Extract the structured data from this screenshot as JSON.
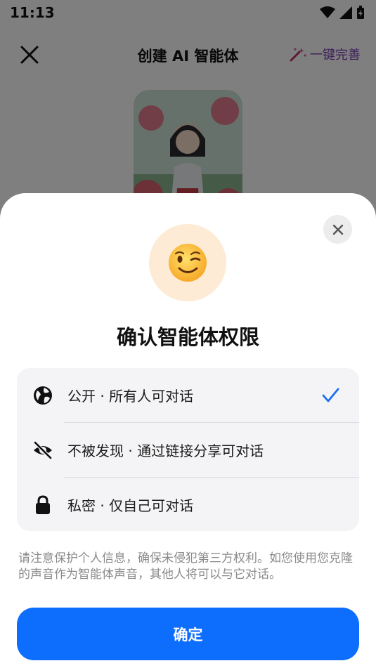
{
  "status_bar": {
    "time": "11:13"
  },
  "app_bar": {
    "title": "创建 AI 智能体",
    "enhance_label": "一键完善"
  },
  "sheet": {
    "title": "确认智能体权限",
    "options": [
      {
        "label": "公开 · 所有人可对话",
        "icon": "globe-icon",
        "selected": true
      },
      {
        "label": "不被发现 · 通过链接分享可对话",
        "icon": "eye-off-icon",
        "selected": false
      },
      {
        "label": "私密 · 仅自己可对话",
        "icon": "lock-icon",
        "selected": false
      }
    ],
    "notice": "请注意保护个人信息，确保未侵犯第三方权利。如您使用您克隆的声音作为智能体声音，其他人将可以与它对话。",
    "confirm_label": "确定"
  },
  "colors": {
    "accent": "#0d6efd",
    "check": "#1a6df0",
    "emoji_bg": "#fdebd6"
  }
}
